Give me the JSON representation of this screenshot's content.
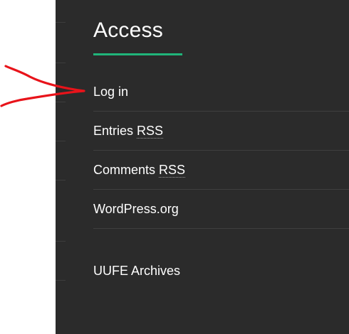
{
  "widget": {
    "title": "Access",
    "links": [
      {
        "text": "Log in"
      },
      {
        "text": "Entries",
        "suffix": "RSS"
      },
      {
        "text": "Comments",
        "suffix": "RSS"
      },
      {
        "text": "WordPress.org"
      }
    ],
    "archives_label": "UUFE Archives"
  },
  "colors": {
    "panel_background": "#2b2b2b",
    "title_underline": "#20b57a",
    "annotation_arrow": "#e8131a"
  },
  "annotation": {
    "icon": "red-arrow-icon"
  }
}
